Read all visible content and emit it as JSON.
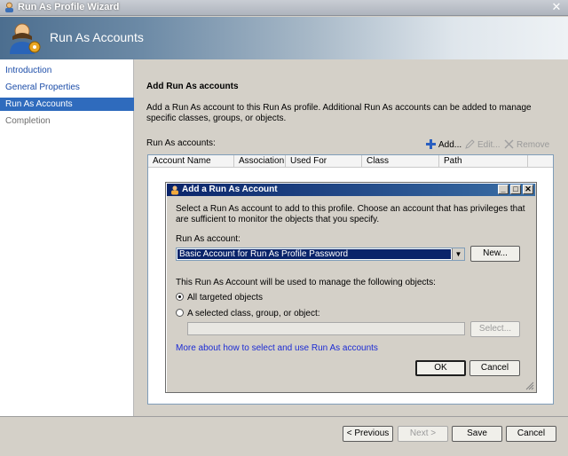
{
  "window": {
    "title": "Run As Profile Wizard",
    "close_glyph": "✕"
  },
  "header": {
    "title": "Run As Accounts"
  },
  "nav": {
    "items": [
      {
        "label": "Introduction"
      },
      {
        "label": "General Properties"
      },
      {
        "label": "Run As Accounts"
      },
      {
        "label": "Completion"
      }
    ]
  },
  "main": {
    "section_title": "Add Run As accounts",
    "description": "Add a Run As account to this Run As profile.  Additional Run As accounts can be added to manage specific classes, groups, or objects.",
    "list_label": "Run As accounts:",
    "toolbar": {
      "add": "Add...",
      "edit": "Edit...",
      "remove": "Remove"
    },
    "columns": [
      "Account Name",
      "Association",
      "Used For",
      "Class",
      "Path"
    ]
  },
  "dialog": {
    "title": "Add a Run As Account",
    "description": "Select a Run As account to add to this profile.  Choose an account that has privileges that are sufficient to monitor the objects that you specify.",
    "account_label": "Run As account:",
    "account_value": "Basic Account for Run As Profile Password",
    "new_button": "New...",
    "manage_label": "This Run As Account will be used to manage the following objects:",
    "option_all": "All targeted objects",
    "option_selected": "A selected class, group, or object:",
    "select_button": "Select...",
    "link": "More about how to select and use Run As accounts",
    "ok_button": "OK",
    "cancel_button": "Cancel",
    "min_glyph": "_",
    "max_glyph": "□",
    "close_glyph": "✕"
  },
  "footer": {
    "previous": "< Previous",
    "next": "Next >",
    "save": "Save",
    "cancel": "Cancel"
  }
}
